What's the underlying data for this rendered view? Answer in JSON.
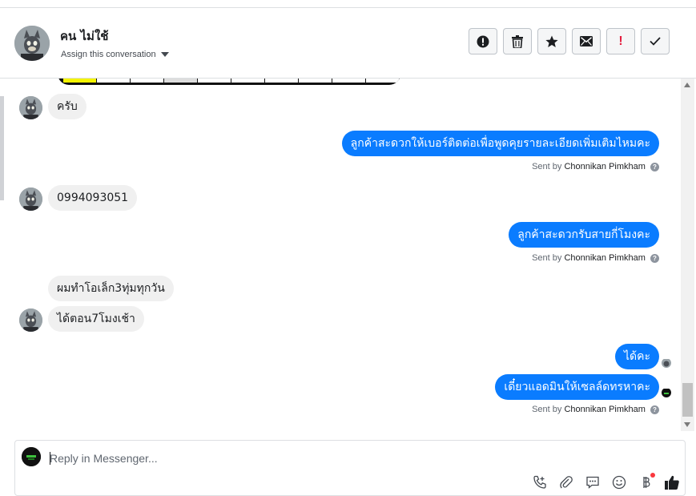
{
  "contact": {
    "name": "คน ไม่ใช้",
    "assign_label": "Assign this conversation"
  },
  "header_actions": [
    {
      "icon": "report-spam-icon"
    },
    {
      "icon": "trash-icon"
    },
    {
      "icon": "star-icon"
    },
    {
      "icon": "mail-icon"
    },
    {
      "icon": "mark-important-icon"
    },
    {
      "icon": "check-icon"
    }
  ],
  "messages": {
    "m1": "ครับ",
    "m2": "ลูกค้าสะดวกให้เบอร์ติดต่อเพื่อพูดคุยรายละเอียดเพิ่มเติมไหมคะ",
    "m3": "0994093051",
    "m4": "ลูกค้าสะดวกรับสายกี่โมงคะ",
    "m5": "ผมทำโอเล็ก3ทุ่มทุกวัน",
    "m6": "ได้ตอน7โมงเช้า",
    "m7": "ได้คะ",
    "m8": "เดี๋ยวแอดมินให้เซลล์ดทรหาคะ"
  },
  "sent_by": {
    "prefix": "Sent by",
    "agent": "Chonnikan Pimkham",
    "help": "?"
  },
  "composer": {
    "placeholder": "Reply in Messenger...",
    "tools": [
      "call-icon",
      "attachment-icon",
      "saved-reply-icon",
      "emoji-icon",
      "payment-icon",
      "like-icon"
    ]
  },
  "colors": {
    "outgoing_bubble": "#0a7cff",
    "incoming_bubble": "#f0f0f0",
    "notification_dot": "#fa383e"
  }
}
